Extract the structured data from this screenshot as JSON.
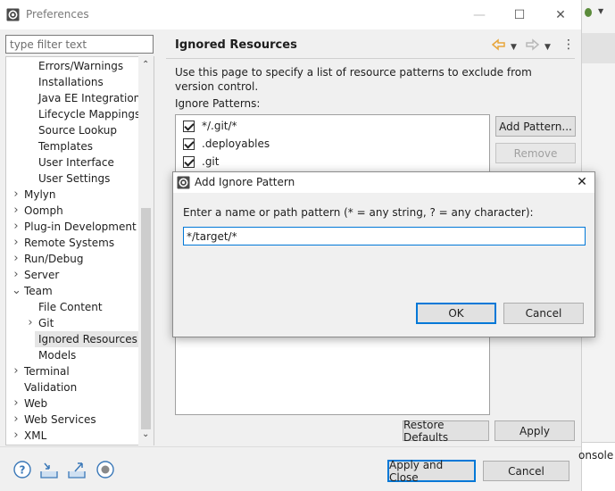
{
  "window": {
    "title": "Preferences",
    "minimize_glyph": "—",
    "maximize_glyph": "☐",
    "close_glyph": "✕"
  },
  "filter": {
    "placeholder": "type filter text",
    "value": ""
  },
  "tree": {
    "items": [
      {
        "label": "Errors/Warnings",
        "level": 2,
        "twisty": ""
      },
      {
        "label": "Installations",
        "level": 2,
        "twisty": ""
      },
      {
        "label": "Java EE Integration",
        "level": 2,
        "twisty": ""
      },
      {
        "label": "Lifecycle Mappings",
        "level": 2,
        "twisty": ""
      },
      {
        "label": "Source Lookup",
        "level": 2,
        "twisty": ""
      },
      {
        "label": "Templates",
        "level": 2,
        "twisty": ""
      },
      {
        "label": "User Interface",
        "level": 2,
        "twisty": ""
      },
      {
        "label": "User Settings",
        "level": 2,
        "twisty": ""
      },
      {
        "label": "Mylyn",
        "level": 1,
        "twisty": "›"
      },
      {
        "label": "Oomph",
        "level": 1,
        "twisty": "›"
      },
      {
        "label": "Plug-in Development",
        "level": 1,
        "twisty": "›"
      },
      {
        "label": "Remote Systems",
        "level": 1,
        "twisty": "›"
      },
      {
        "label": "Run/Debug",
        "level": 1,
        "twisty": "›"
      },
      {
        "label": "Server",
        "level": 1,
        "twisty": "›"
      },
      {
        "label": "Team",
        "level": 1,
        "twisty": "⌄"
      },
      {
        "label": "File Content",
        "level": 2,
        "twisty": ""
      },
      {
        "label": "Git",
        "level": 2,
        "twisty": "›"
      },
      {
        "label": "Ignored Resources",
        "level": 2,
        "twisty": "",
        "selected": true
      },
      {
        "label": "Models",
        "level": 2,
        "twisty": ""
      },
      {
        "label": "Terminal",
        "level": 1,
        "twisty": "›"
      },
      {
        "label": "Validation",
        "level": 1,
        "twisty": ""
      },
      {
        "label": "Web",
        "level": 1,
        "twisty": "›"
      },
      {
        "label": "Web Services",
        "level": 1,
        "twisty": "›"
      },
      {
        "label": "XML",
        "level": 1,
        "twisty": "›"
      }
    ]
  },
  "page": {
    "title": "Ignored Resources",
    "description": "Use this page to specify a list of resource patterns to exclude from version control.",
    "patterns_label": "Ignore Patterns:",
    "patterns": [
      {
        "pattern": "*/.git/*",
        "checked": true
      },
      {
        "pattern": ".deployables",
        "checked": true
      },
      {
        "pattern": ".git",
        "checked": true
      }
    ],
    "add_pattern_button": "Add Pattern...",
    "remove_button": "Remove",
    "restore_defaults_button": "Restore Defaults",
    "apply_button": "Apply"
  },
  "footer": {
    "apply_and_close_button": "Apply and Close",
    "cancel_button": "Cancel"
  },
  "dialog": {
    "title": "Add Ignore Pattern",
    "message": "Enter a name or path pattern (* = any string, ? = any character):",
    "input_value": "*/target/*",
    "ok_button": "OK",
    "cancel_button": "Cancel",
    "close_glyph": "✕"
  },
  "background": {
    "console_label": "onsole"
  },
  "colors": {
    "accent": "#0078d7",
    "selection": "#e5e5e5",
    "nav_back": "#e8a53a"
  }
}
